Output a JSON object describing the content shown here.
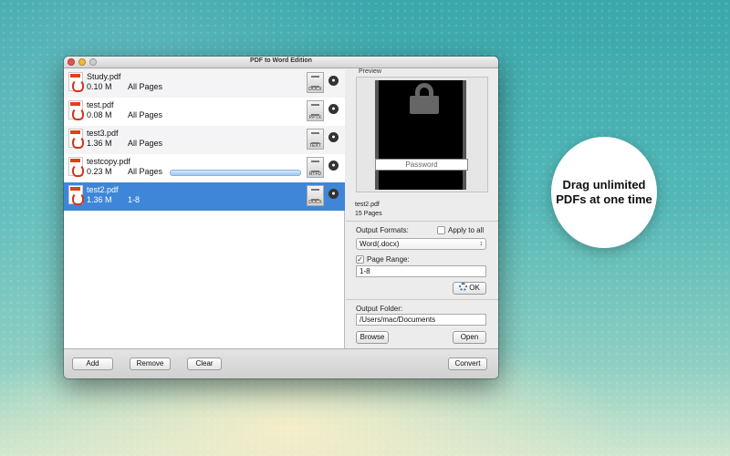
{
  "window": {
    "title": "PDF to Word Edition"
  },
  "files": [
    {
      "name": "Study.pdf",
      "size": "0.10 M",
      "pages": "All Pages",
      "format": "DOCX"
    },
    {
      "name": "test.pdf",
      "size": "0.08 M",
      "pages": "All Pages",
      "format": "PPTX"
    },
    {
      "name": "test3.pdf",
      "size": "1.36 M",
      "pages": "All Pages",
      "format": "TEXT"
    },
    {
      "name": "testcopy.pdf",
      "size": "0.23 M",
      "pages": "All Pages",
      "format": "RTFD"
    },
    {
      "name": "test2.pdf",
      "size": "1.36 M",
      "pages": "1-8",
      "format": "DOCX"
    }
  ],
  "selected_file_index": 4,
  "preview": {
    "label": "Preview",
    "password_placeholder": "Password",
    "file_name": "test2.pdf",
    "page_count": "15 Pages"
  },
  "output": {
    "formats_label": "Output Formats:",
    "apply_all_label": "Apply to all",
    "format_selected": "Word(.docx)",
    "page_range_label": "Page Range:",
    "page_range_value": "1-8",
    "ok_label": "OK",
    "folder_label": "Output Folder:",
    "folder_value": "/Users/mac/Documents",
    "browse_label": "Browse",
    "open_label": "Open"
  },
  "toolbar": {
    "add_label": "Add",
    "remove_label": "Remove",
    "clear_label": "Clear",
    "convert_label": "Convert"
  },
  "promo": {
    "line1": "Drag unlimited",
    "line2": "PDFs at one time"
  }
}
